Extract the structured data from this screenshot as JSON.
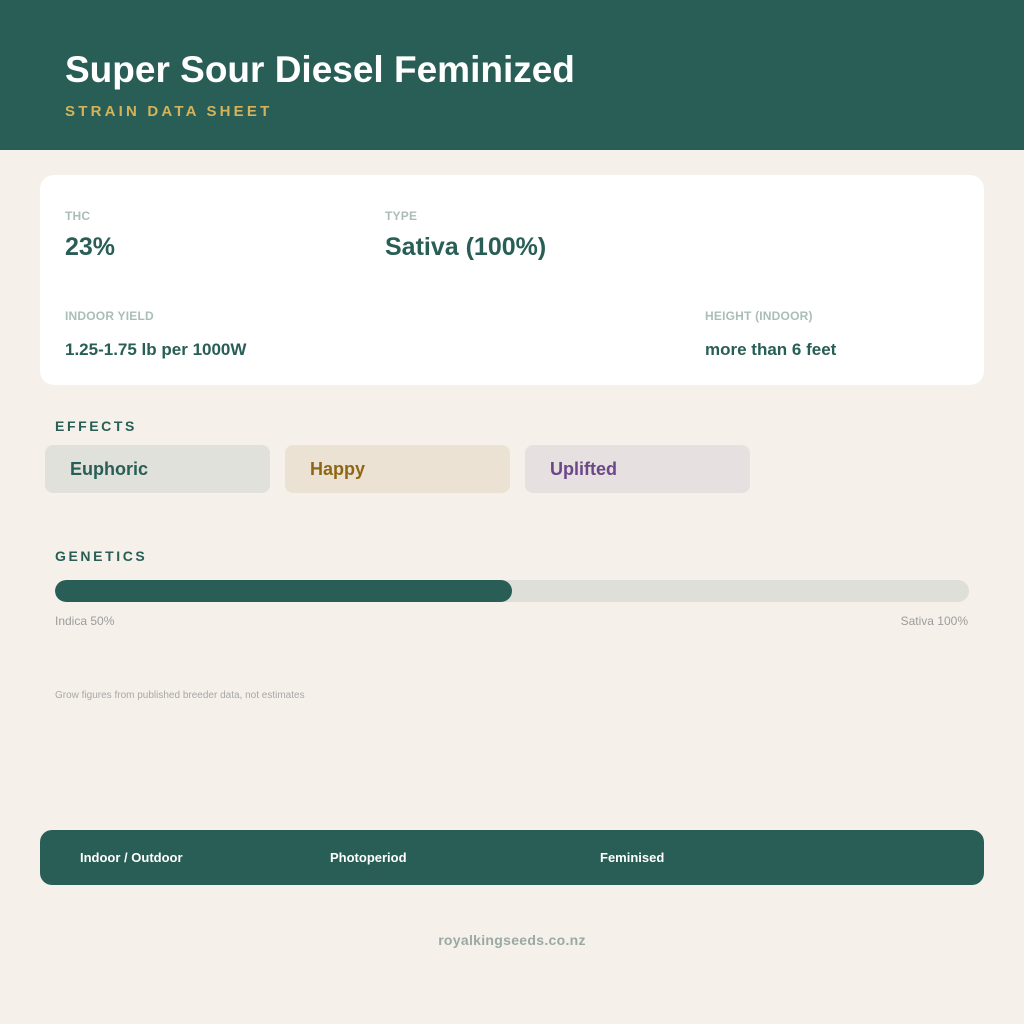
{
  "header": {
    "title": "Super Sour Diesel Feminized",
    "subtitle": "STRAIN DATA SHEET"
  },
  "stats": {
    "thc": {
      "label": "THC",
      "value": "23%"
    },
    "type": {
      "label": "TYPE",
      "value": "Sativa (100%)"
    },
    "indoor_yield": {
      "label": "INDOOR YIELD",
      "value": "1.25-1.75 lb per 1000W"
    },
    "height_indoor": {
      "label": "HEIGHT (INDOOR)",
      "value": "more than 6 feet"
    }
  },
  "effects": {
    "label": "EFFECTS",
    "items": [
      {
        "label": "Euphoric",
        "color": "#285e55"
      },
      {
        "label": "Happy",
        "color": "#8e6716"
      },
      {
        "label": "Uplifted",
        "color": "#6b4788"
      }
    ]
  },
  "genetics": {
    "label": "GENETICS",
    "fill_fraction": 0.5,
    "left_label": "Indica 50%",
    "right_label": "Sativa 100%"
  },
  "note": "Grow figures from published breeder data, not estimates",
  "footer": {
    "items": [
      "Indoor / Outdoor",
      "Photoperiod",
      "Feminised"
    ]
  },
  "website": "royalkingseeds.co.nz",
  "colors": {
    "primary": "#285e55",
    "accent": "#d4b35a",
    "background": "#f5f0ea"
  }
}
